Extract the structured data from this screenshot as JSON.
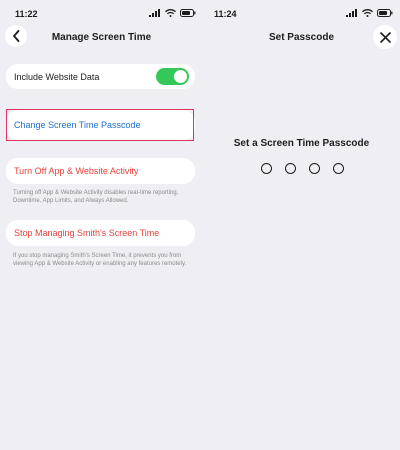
{
  "left": {
    "status_time": "11:22",
    "nav_title": "Manage Screen Time",
    "include_website_label": "Include Website Data",
    "toggle_on": true,
    "change_passcode_label": "Change Screen Time Passcode",
    "turn_off_label": "Turn Off App & Website Activity",
    "turn_off_note": "Turning off App & Website Activity disables real-time reporting, Downtime, App Limits, and Always Allowed.",
    "stop_managing_label": "Stop Managing Smith's Screen Time",
    "stop_managing_note": "If you stop managing Smith's Screen Time, it prevents you from viewing App & Website Activity or enabling any features remotely."
  },
  "right": {
    "status_time": "11:24",
    "nav_title": "Set Passcode",
    "prompt": "Set a Screen Time Passcode",
    "passcode_digits": 4
  },
  "icons": {
    "back": "chevron-left-icon",
    "close": "close-icon",
    "signal": "signal-icon",
    "wifi": "wifi-icon",
    "battery": "battery-icon"
  },
  "colors": {
    "background": "#efeef4",
    "toggle_on": "#34c759",
    "link_blue": "#1f6fd1",
    "link_red": "#e8423a",
    "highlight": "#e0325c"
  }
}
